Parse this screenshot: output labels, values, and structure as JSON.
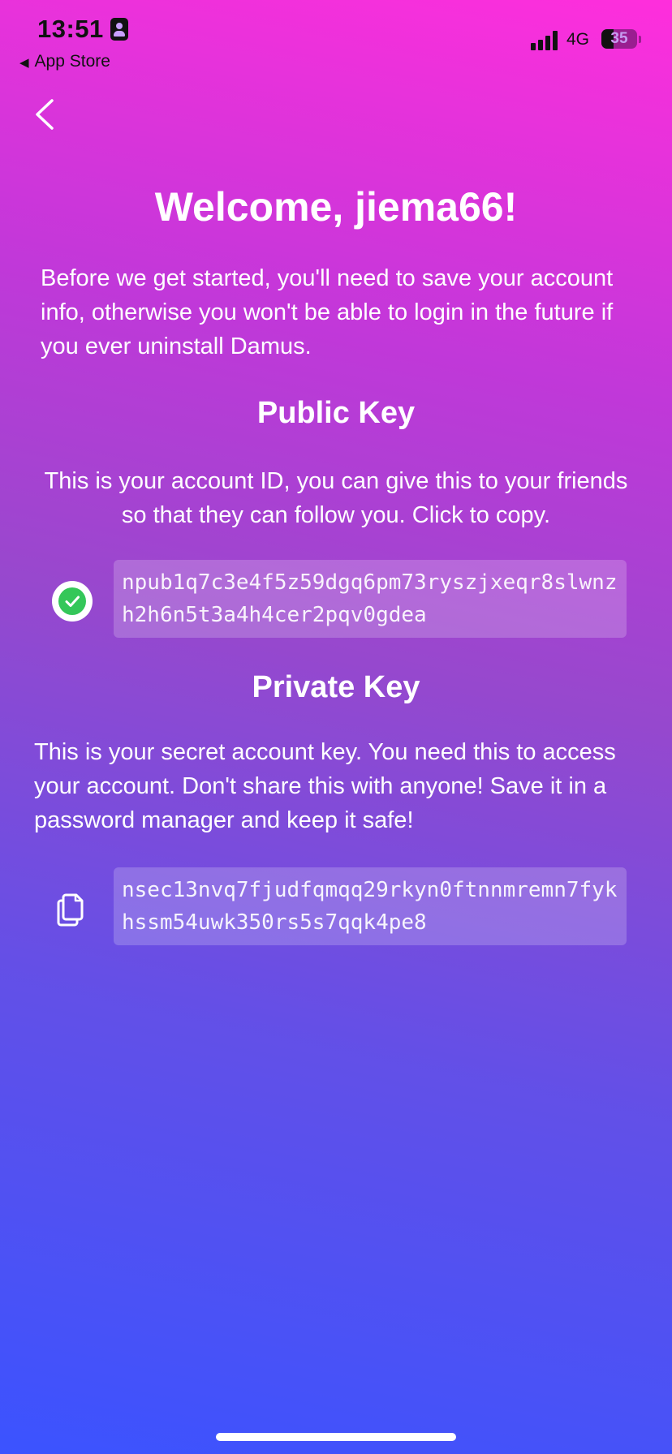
{
  "status_bar": {
    "time": "13:51",
    "back_to_app": "App Store",
    "network": "4G",
    "battery_level": "35",
    "battery_percent": 35
  },
  "screen": {
    "title": "Welcome, jiema66!",
    "intro": "Before we get started, you'll need to save your account info, otherwise you won't be able to login in the future if you ever uninstall Damus.",
    "public_key": {
      "heading": "Public Key",
      "description": "This is your account ID, you can give this to your friends so that they can follow you. Click to copy.",
      "value": "npub1q7c3e4f5z59dgq6pm73ryszjxeqr8slwnzh2h6n5t3a4h4cer2pqv0gdea",
      "status_icon": "checkmark-circle-icon",
      "copied": true
    },
    "private_key": {
      "heading": "Private Key",
      "description": "This is your secret account key. You need this to access your account. Don't share this with anyone! Save it in a password manager and keep it safe!",
      "value": "nsec13nvq7fjudfqmqq29rkyn0ftnnmremn7fykhssm54uwk350rs5s7qqk4pe8",
      "action_icon": "copy-icon"
    }
  },
  "colors": {
    "gradient_top": "#ff2edc",
    "gradient_bottom": "#3b53ff",
    "success": "#34c759",
    "text": "#ffffff"
  }
}
